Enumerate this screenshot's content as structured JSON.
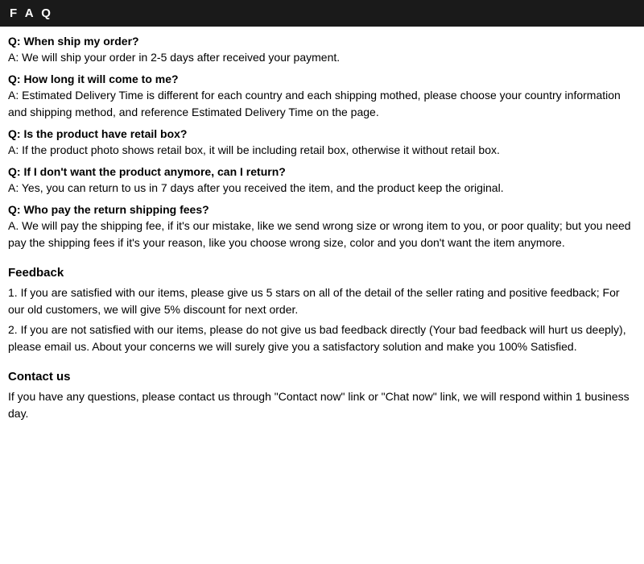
{
  "header": {
    "title": "F A Q"
  },
  "faq": [
    {
      "question": "Q: When ship my order?",
      "answer": "A: We will ship your order in 2-5 days after received your payment."
    },
    {
      "question": "Q: How long it will come to me?",
      "answer": "A: Estimated Delivery Time is different for each country and each shipping mothed, please choose your country information and shipping method, and reference Estimated Delivery Time on the page."
    },
    {
      "question": "Q: Is the product have retail box?",
      "answer": "A: If the product photo shows retail box, it will be including retail box, otherwise it without retail box."
    },
    {
      "question": "Q: If I don't want the product anymore, can I return?",
      "answer": "A: Yes, you can return to us in 7 days after you received the item, and the product keep the original."
    },
    {
      "question": "Q: Who pay the return shipping fees?",
      "answer": "A. We will pay the shipping fee, if it's our mistake, like we send wrong size or wrong item to you, or poor quality; but you need pay the shipping fees if it's your reason, like you choose wrong size, color and you don't want the item anymore."
    }
  ],
  "feedback": {
    "title": "Feedback",
    "items": [
      "1.  If you are satisfied with our items, please give us 5 stars on all of the detail of the seller rating and positive feedback; For our old customers, we will give 5% discount for next order.",
      "2.  If you are not satisfied with our items, please do not give us bad feedback directly (Your bad feedback will hurt us deeply), please email us. About your concerns we will surely give you a satisfactory solution and make you 100% Satisfied."
    ]
  },
  "contact": {
    "title": "Contact us",
    "text": "If you have any questions, please contact us through \"Contact now\" link or \"Chat now\" link, we will respond within 1 business day."
  }
}
